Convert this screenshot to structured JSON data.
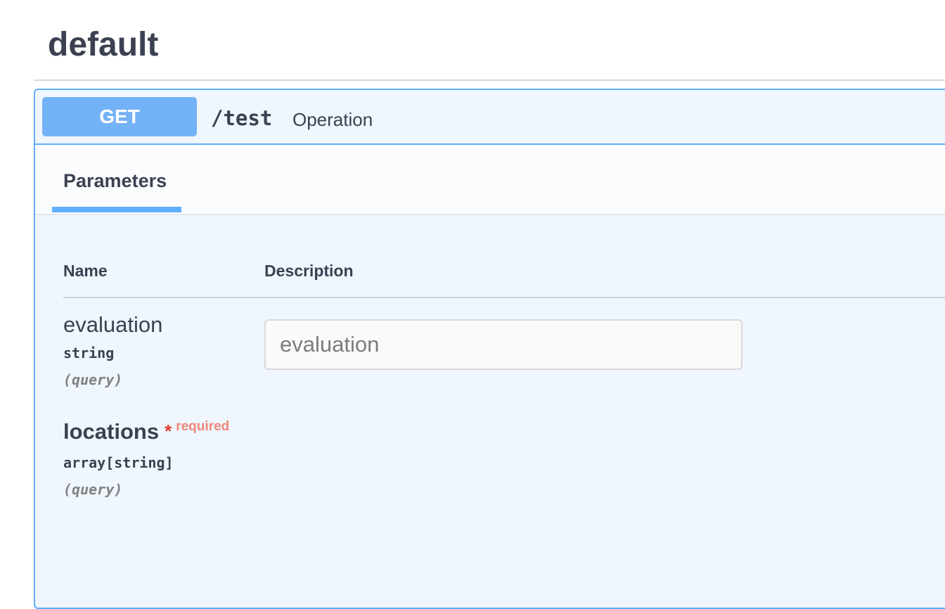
{
  "section": {
    "title": "default"
  },
  "operation": {
    "method": "GET",
    "path": "/test",
    "summary": "Operation",
    "accent_color": "#61affe",
    "badge_color": "#74b2f7",
    "background_color": "#eff6fe"
  },
  "tabs": [
    {
      "label": "Parameters",
      "active": true
    }
  ],
  "parameters_table": {
    "columns": [
      "Name",
      "Description"
    ],
    "rows": [
      {
        "name": "evaluation",
        "type": "string",
        "in": "(query)",
        "required": false,
        "input_placeholder": "evaluation"
      },
      {
        "name": "locations",
        "type": "array[string]",
        "in": "(query)",
        "required": true,
        "required_star": "*",
        "required_label": "required"
      }
    ]
  }
}
